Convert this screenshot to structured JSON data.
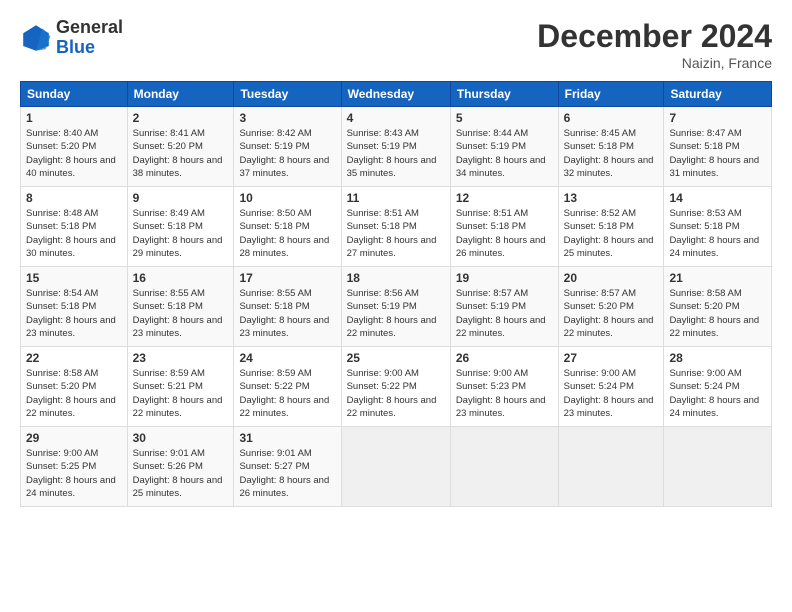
{
  "header": {
    "logo_general": "General",
    "logo_blue": "Blue",
    "month_title": "December 2024",
    "location": "Naizin, France"
  },
  "weekdays": [
    "Sunday",
    "Monday",
    "Tuesday",
    "Wednesday",
    "Thursday",
    "Friday",
    "Saturday"
  ],
  "weeks": [
    [
      {
        "day": "1",
        "sunrise": "Sunrise: 8:40 AM",
        "sunset": "Sunset: 5:20 PM",
        "daylight": "Daylight: 8 hours and 40 minutes."
      },
      {
        "day": "2",
        "sunrise": "Sunrise: 8:41 AM",
        "sunset": "Sunset: 5:20 PM",
        "daylight": "Daylight: 8 hours and 38 minutes."
      },
      {
        "day": "3",
        "sunrise": "Sunrise: 8:42 AM",
        "sunset": "Sunset: 5:19 PM",
        "daylight": "Daylight: 8 hours and 37 minutes."
      },
      {
        "day": "4",
        "sunrise": "Sunrise: 8:43 AM",
        "sunset": "Sunset: 5:19 PM",
        "daylight": "Daylight: 8 hours and 35 minutes."
      },
      {
        "day": "5",
        "sunrise": "Sunrise: 8:44 AM",
        "sunset": "Sunset: 5:19 PM",
        "daylight": "Daylight: 8 hours and 34 minutes."
      },
      {
        "day": "6",
        "sunrise": "Sunrise: 8:45 AM",
        "sunset": "Sunset: 5:18 PM",
        "daylight": "Daylight: 8 hours and 32 minutes."
      },
      {
        "day": "7",
        "sunrise": "Sunrise: 8:47 AM",
        "sunset": "Sunset: 5:18 PM",
        "daylight": "Daylight: 8 hours and 31 minutes."
      }
    ],
    [
      {
        "day": "8",
        "sunrise": "Sunrise: 8:48 AM",
        "sunset": "Sunset: 5:18 PM",
        "daylight": "Daylight: 8 hours and 30 minutes."
      },
      {
        "day": "9",
        "sunrise": "Sunrise: 8:49 AM",
        "sunset": "Sunset: 5:18 PM",
        "daylight": "Daylight: 8 hours and 29 minutes."
      },
      {
        "day": "10",
        "sunrise": "Sunrise: 8:50 AM",
        "sunset": "Sunset: 5:18 PM",
        "daylight": "Daylight: 8 hours and 28 minutes."
      },
      {
        "day": "11",
        "sunrise": "Sunrise: 8:51 AM",
        "sunset": "Sunset: 5:18 PM",
        "daylight": "Daylight: 8 hours and 27 minutes."
      },
      {
        "day": "12",
        "sunrise": "Sunrise: 8:51 AM",
        "sunset": "Sunset: 5:18 PM",
        "daylight": "Daylight: 8 hours and 26 minutes."
      },
      {
        "day": "13",
        "sunrise": "Sunrise: 8:52 AM",
        "sunset": "Sunset: 5:18 PM",
        "daylight": "Daylight: 8 hours and 25 minutes."
      },
      {
        "day": "14",
        "sunrise": "Sunrise: 8:53 AM",
        "sunset": "Sunset: 5:18 PM",
        "daylight": "Daylight: 8 hours and 24 minutes."
      }
    ],
    [
      {
        "day": "15",
        "sunrise": "Sunrise: 8:54 AM",
        "sunset": "Sunset: 5:18 PM",
        "daylight": "Daylight: 8 hours and 23 minutes."
      },
      {
        "day": "16",
        "sunrise": "Sunrise: 8:55 AM",
        "sunset": "Sunset: 5:18 PM",
        "daylight": "Daylight: 8 hours and 23 minutes."
      },
      {
        "day": "17",
        "sunrise": "Sunrise: 8:55 AM",
        "sunset": "Sunset: 5:18 PM",
        "daylight": "Daylight: 8 hours and 23 minutes."
      },
      {
        "day": "18",
        "sunrise": "Sunrise: 8:56 AM",
        "sunset": "Sunset: 5:19 PM",
        "daylight": "Daylight: 8 hours and 22 minutes."
      },
      {
        "day": "19",
        "sunrise": "Sunrise: 8:57 AM",
        "sunset": "Sunset: 5:19 PM",
        "daylight": "Daylight: 8 hours and 22 minutes."
      },
      {
        "day": "20",
        "sunrise": "Sunrise: 8:57 AM",
        "sunset": "Sunset: 5:20 PM",
        "daylight": "Daylight: 8 hours and 22 minutes."
      },
      {
        "day": "21",
        "sunrise": "Sunrise: 8:58 AM",
        "sunset": "Sunset: 5:20 PM",
        "daylight": "Daylight: 8 hours and 22 minutes."
      }
    ],
    [
      {
        "day": "22",
        "sunrise": "Sunrise: 8:58 AM",
        "sunset": "Sunset: 5:20 PM",
        "daylight": "Daylight: 8 hours and 22 minutes."
      },
      {
        "day": "23",
        "sunrise": "Sunrise: 8:59 AM",
        "sunset": "Sunset: 5:21 PM",
        "daylight": "Daylight: 8 hours and 22 minutes."
      },
      {
        "day": "24",
        "sunrise": "Sunrise: 8:59 AM",
        "sunset": "Sunset: 5:22 PM",
        "daylight": "Daylight: 8 hours and 22 minutes."
      },
      {
        "day": "25",
        "sunrise": "Sunrise: 9:00 AM",
        "sunset": "Sunset: 5:22 PM",
        "daylight": "Daylight: 8 hours and 22 minutes."
      },
      {
        "day": "26",
        "sunrise": "Sunrise: 9:00 AM",
        "sunset": "Sunset: 5:23 PM",
        "daylight": "Daylight: 8 hours and 23 minutes."
      },
      {
        "day": "27",
        "sunrise": "Sunrise: 9:00 AM",
        "sunset": "Sunset: 5:24 PM",
        "daylight": "Daylight: 8 hours and 23 minutes."
      },
      {
        "day": "28",
        "sunrise": "Sunrise: 9:00 AM",
        "sunset": "Sunset: 5:24 PM",
        "daylight": "Daylight: 8 hours and 24 minutes."
      }
    ],
    [
      {
        "day": "29",
        "sunrise": "Sunrise: 9:00 AM",
        "sunset": "Sunset: 5:25 PM",
        "daylight": "Daylight: 8 hours and 24 minutes."
      },
      {
        "day": "30",
        "sunrise": "Sunrise: 9:01 AM",
        "sunset": "Sunset: 5:26 PM",
        "daylight": "Daylight: 8 hours and 25 minutes."
      },
      {
        "day": "31",
        "sunrise": "Sunrise: 9:01 AM",
        "sunset": "Sunset: 5:27 PM",
        "daylight": "Daylight: 8 hours and 26 minutes."
      },
      null,
      null,
      null,
      null
    ]
  ]
}
